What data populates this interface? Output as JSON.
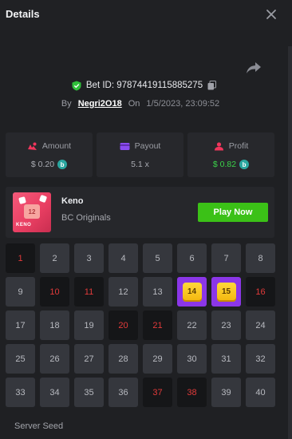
{
  "header": {
    "title": "Details"
  },
  "bet": {
    "id_text": "Bet ID: 97874419115885275",
    "by_label": "By",
    "user": "Negri2O18",
    "on_label": "On",
    "date": "1/5/2023, 23:09:52"
  },
  "stats": [
    {
      "label": "Amount",
      "value": "$ 0.20",
      "icon": "coins-icon",
      "coin": true
    },
    {
      "label": "Payout",
      "value": "5.1 x",
      "icon": "wallet-icon",
      "coin": false
    },
    {
      "label": "Profit",
      "value": "$ 0.82",
      "icon": "profit-icon",
      "coin": true
    }
  ],
  "game": {
    "name": "Keno",
    "provider": "BC Originals",
    "play_label": "Play Now",
    "thumb_number": "12",
    "thumb_text": "KENO"
  },
  "grid": {
    "numbers": [
      1,
      2,
      3,
      4,
      5,
      6,
      7,
      8,
      9,
      10,
      11,
      12,
      13,
      14,
      15,
      16,
      17,
      18,
      19,
      20,
      21,
      22,
      23,
      24,
      25,
      26,
      27,
      28,
      29,
      30,
      31,
      32,
      33,
      34,
      35,
      36,
      37,
      38,
      39,
      40
    ],
    "drawn": [
      1,
      10,
      11,
      16,
      20,
      21,
      37,
      38
    ],
    "hits": [
      14,
      15
    ]
  },
  "footer": {
    "server_seed_label": "Server Seed"
  },
  "colors": {
    "accent_green": "#3bc117",
    "hit_purple": "#8b36e8",
    "drawn_red": "#e23a3a",
    "coin_teal": "#2ba7a0"
  }
}
